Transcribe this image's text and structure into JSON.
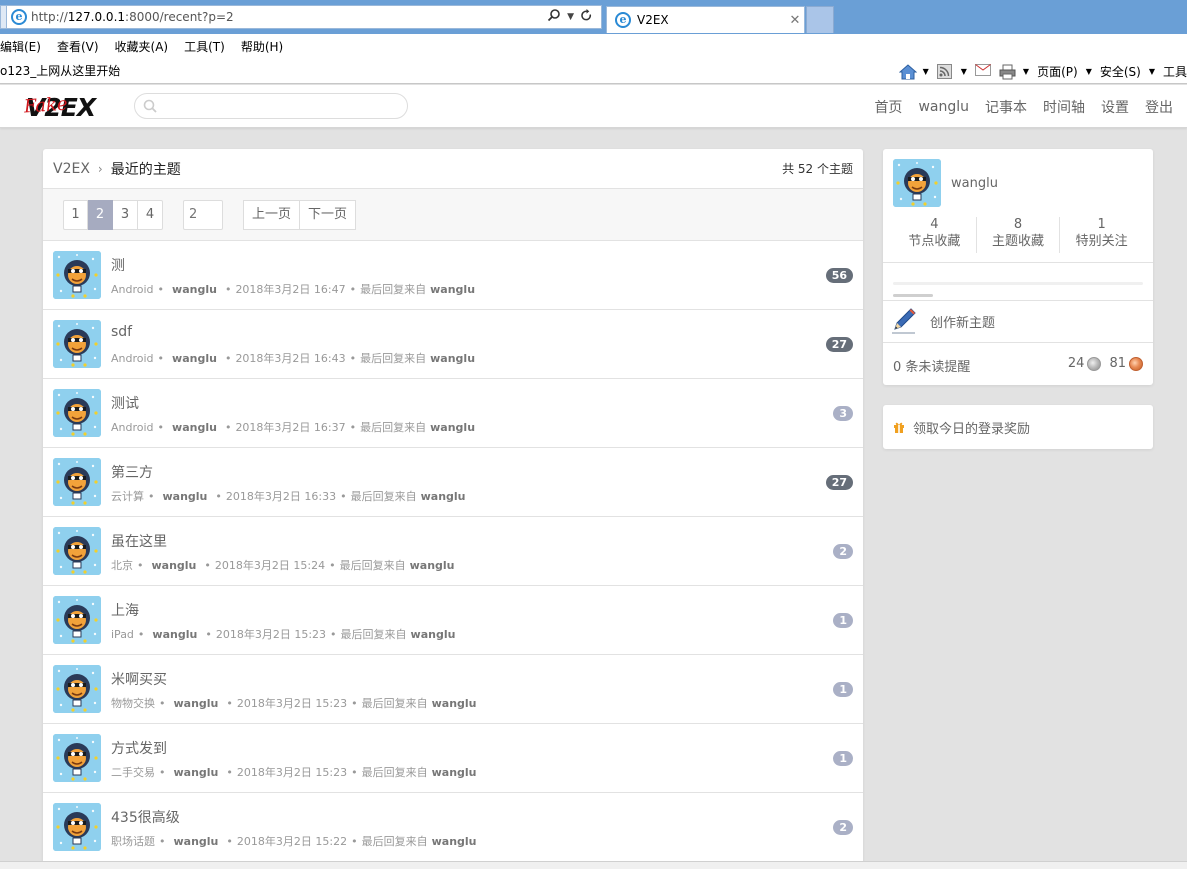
{
  "browser": {
    "url_prefix": "http://",
    "url_host": "127.0.0.1",
    "url_rest": ":8000/recent?p=2",
    "tab_title": "V2EX",
    "tab_close": "✕",
    "menu": [
      "编辑(E)",
      "查看(V)",
      "收藏夹(A)",
      "工具(T)",
      "帮助(H)"
    ],
    "favorite_link": "o123_上网从这里开始",
    "cmd": {
      "page": "页面(P)",
      "safety": "安全(S)",
      "tools": "工具"
    }
  },
  "header": {
    "logo_text": "V2EX",
    "logo_overlay": "Fake",
    "search_placeholder": "",
    "nav": [
      "首页",
      "wanglu",
      "记事本",
      "时间轴",
      "设置",
      "登出"
    ]
  },
  "main": {
    "breadcrumb_root": "V2EX",
    "breadcrumb_sep": "›",
    "breadcrumb_current": "最近的主题",
    "topic_count": "共 52 个主题",
    "pages": [
      "1",
      "2",
      "3",
      "4"
    ],
    "current_page": "2",
    "page_input_placeholder": "2",
    "prev_label": "上一页",
    "next_label": "下一页",
    "last_reply_label": "最后回复来自",
    "topics": [
      {
        "title": "测",
        "node": "Android",
        "author": "wanglu",
        "time": "2018年3月2日 16:47",
        "last_reply_by": "wanglu",
        "replies": "56"
      },
      {
        "title": "sdf",
        "node": "Android",
        "author": "wanglu",
        "time": "2018年3月2日 16:43",
        "last_reply_by": "wanglu",
        "replies": "27"
      },
      {
        "title": "测试",
        "node": "Android",
        "author": "wanglu",
        "time": "2018年3月2日 16:37",
        "last_reply_by": "wanglu",
        "replies": "3"
      },
      {
        "title": "第三方",
        "node": "云计算",
        "author": "wanglu",
        "time": "2018年3月2日 16:33",
        "last_reply_by": "wanglu",
        "replies": "27"
      },
      {
        "title": "虽在这里",
        "node": "北京",
        "author": "wanglu",
        "time": "2018年3月2日 15:24",
        "last_reply_by": "wanglu",
        "replies": "2"
      },
      {
        "title": "上海",
        "node": "iPad",
        "author": "wanglu",
        "time": "2018年3月2日 15:23",
        "last_reply_by": "wanglu",
        "replies": "1"
      },
      {
        "title": "米啊买买",
        "node": "物物交换",
        "author": "wanglu",
        "time": "2018年3月2日 15:23",
        "last_reply_by": "wanglu",
        "replies": "1"
      },
      {
        "title": "方式发到",
        "node": "二手交易",
        "author": "wanglu",
        "time": "2018年3月2日 15:23",
        "last_reply_by": "wanglu",
        "replies": "1"
      },
      {
        "title": "435很高级",
        "node": "职场话题",
        "author": "wanglu",
        "time": "2018年3月2日 15:22",
        "last_reply_by": "wanglu",
        "replies": "2"
      }
    ]
  },
  "sidebar": {
    "username": "wanglu",
    "stats": [
      {
        "num": "4",
        "label": "节点收藏"
      },
      {
        "num": "8",
        "label": "主题收藏"
      },
      {
        "num": "1",
        "label": "特别关注"
      }
    ],
    "progress_fraction": 0.16,
    "create_label": "创作新主题",
    "notifications": "0 条未读提醒",
    "silver": "24",
    "bronze": "81",
    "daily_reward": "领取今日的登录奖励"
  },
  "colors": {
    "page_bg": "#e2e2e2",
    "active_page": "#a6abc0",
    "reply_badge": "#aab0c6",
    "reply_badge_hot": "#666e79",
    "logo_red": "#d0171d",
    "ie_blue": "#6a9fd6"
  },
  "icons": {
    "browser_logo": "ie-logo-icon",
    "search": "search-icon",
    "refresh": "refresh-icon",
    "home": "home-icon",
    "rss": "rss-icon",
    "mail": "mail-icon",
    "print": "print-icon",
    "create": "pencil-icon",
    "gift": "gift-icon"
  }
}
